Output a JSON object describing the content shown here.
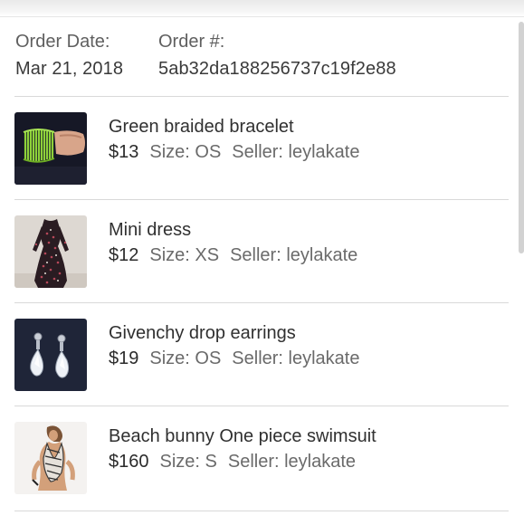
{
  "order": {
    "date_label": "Order Date:",
    "date_value": "Mar 21, 2018",
    "number_label": "Order #:",
    "number_value": "5ab32da188256737c19f2e88"
  },
  "items": [
    {
      "title": "Green braided bracelet",
      "price": "$13",
      "size": "Size: OS",
      "seller": "Seller: leylakate",
      "thumbnail": "green-bracelet-photo"
    },
    {
      "title": "Mini dress",
      "price": "$12",
      "size": "Size: XS",
      "seller": "Seller: leylakate",
      "thumbnail": "floral-mini-dress-photo"
    },
    {
      "title": "Givenchy drop earrings",
      "price": "$19",
      "size": "Size: OS",
      "seller": "Seller: leylakate",
      "thumbnail": "crystal-drop-earrings-photo"
    },
    {
      "title": "Beach bunny One piece swimsuit",
      "price": "$160",
      "size": "Size: S",
      "seller": "Seller: leylakate",
      "thumbnail": "swimsuit-model-photo"
    }
  ]
}
